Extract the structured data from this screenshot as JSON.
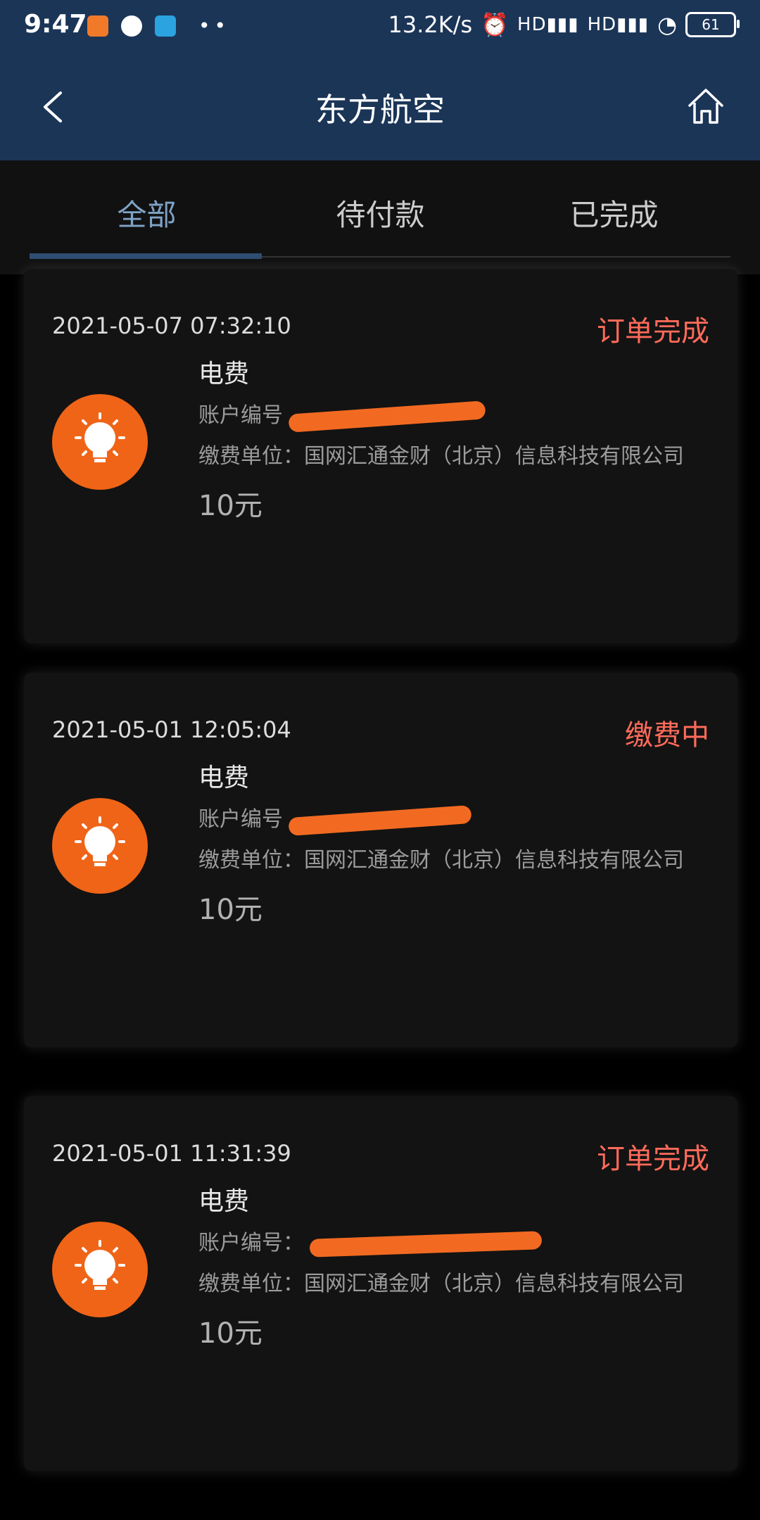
{
  "status_bar": {
    "time": "9:47",
    "network_speed": "13.2K/s",
    "signal_1": "HD",
    "signal_2": "HD",
    "battery": "61",
    "dots": "••"
  },
  "header": {
    "title": "东方航空"
  },
  "tabs": [
    {
      "label": "全部",
      "active": true
    },
    {
      "label": "待付款",
      "active": false
    },
    {
      "label": "已完成",
      "active": false
    }
  ],
  "orders": [
    {
      "time": "2021-05-07 07:32:10",
      "status": "订单完成",
      "title": "电费",
      "account_label": "账户编号",
      "unit_label": "缴费单位：国网汇通金财（北京）信息科技有限公司",
      "amount": "10元"
    },
    {
      "time": "2021-05-01 12:05:04",
      "status": "缴费中",
      "title": "电费",
      "account_label": "账户编号",
      "unit_label": "缴费单位：国网汇通金财（北京）信息科技有限公司",
      "amount": "10元"
    },
    {
      "time": "2021-05-01 11:31:39",
      "status": "订单完成",
      "title": "电费",
      "account_label": "账户编号：",
      "unit_label": "缴费单位：国网汇通金财（北京）信息科技有限公司",
      "amount": "10元"
    }
  ],
  "colors": {
    "header_bg": "#1b3557",
    "status_red": "#ff6b5a",
    "icon_orange": "#f06417"
  }
}
